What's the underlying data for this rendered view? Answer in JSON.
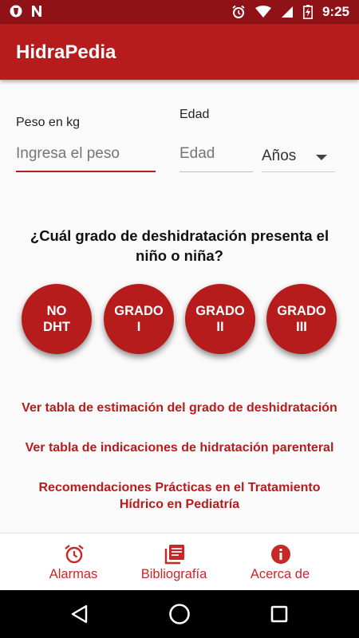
{
  "status_bar": {
    "time": "9:25"
  },
  "app": {
    "title": "HidraPedia",
    "accent": "#b71c1c",
    "status_color": "#8e1216"
  },
  "form": {
    "weight_label": "Peso en kg",
    "weight_placeholder": "Ingresa el peso",
    "age_label": "Edad",
    "age_placeholder": "Edad",
    "age_unit": "Años"
  },
  "question": "¿Cuál grado de deshidratación presenta el niño o niña?",
  "grades": [
    {
      "label": "NO\nDHT"
    },
    {
      "label": "GRADO\nI"
    },
    {
      "label": "GRADO\nII"
    },
    {
      "label": "GRADO\nIII"
    }
  ],
  "links": [
    {
      "text": "Ver tabla de estimación del grado de deshidratación"
    },
    {
      "text": "Ver tabla de indicaciones de hidratación parenteral"
    },
    {
      "text": "Recomendaciones Prácticas en el Tratamiento Hídrico en Pediatría"
    }
  ],
  "bottom_nav": [
    {
      "label": "Alarmas",
      "icon": "alarm-icon"
    },
    {
      "label": "Bibliografía",
      "icon": "library-books-icon"
    },
    {
      "label": "Acerca de",
      "icon": "info-icon"
    }
  ]
}
